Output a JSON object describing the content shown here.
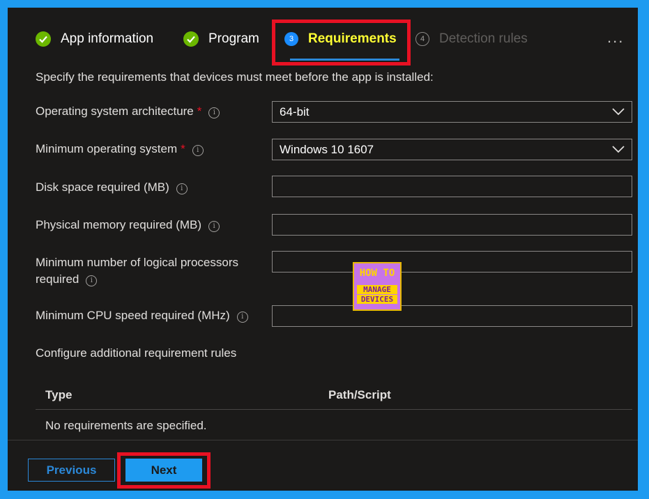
{
  "tabs": [
    {
      "label": "App information",
      "state": "complete",
      "icon": "checkmark-icon"
    },
    {
      "label": "Program",
      "state": "complete",
      "icon": "checkmark-icon"
    },
    {
      "label": "Requirements",
      "state": "current",
      "step": "3"
    },
    {
      "label": "Detection rules",
      "state": "pending",
      "step": "4"
    }
  ],
  "more_label": "...",
  "description": "Specify the requirements that devices must meet before the app is installed:",
  "fields": {
    "os_arch": {
      "label": "Operating system architecture",
      "required": "*",
      "value": "64-bit"
    },
    "min_os": {
      "label": "Minimum operating system",
      "required": "*",
      "value": "Windows 10 1607"
    },
    "disk_space": {
      "label": "Disk space required (MB)",
      "value": ""
    },
    "memory": {
      "label": "Physical memory required (MB)",
      "value": ""
    },
    "processors": {
      "label_line1": "Minimum number of logical processors",
      "label_line2": "required",
      "value": ""
    },
    "cpu_speed": {
      "label": "Minimum CPU speed required (MHz)",
      "value": ""
    }
  },
  "info_glyph": "i",
  "additional_rules_label": "Configure additional requirement rules",
  "table": {
    "columns": [
      "Type",
      "Path/Script"
    ],
    "empty_message": "No requirements are specified."
  },
  "logo": {
    "line1": "HOW TO",
    "line2": "MANAGE",
    "line3": "DEVICES"
  },
  "buttons": {
    "previous": "Previous",
    "next": "Next"
  },
  "colors": {
    "accent": "#1e9bf0",
    "highlight": "#e81123",
    "active_tab_text": "#ffff33",
    "complete": "#6bb700"
  }
}
